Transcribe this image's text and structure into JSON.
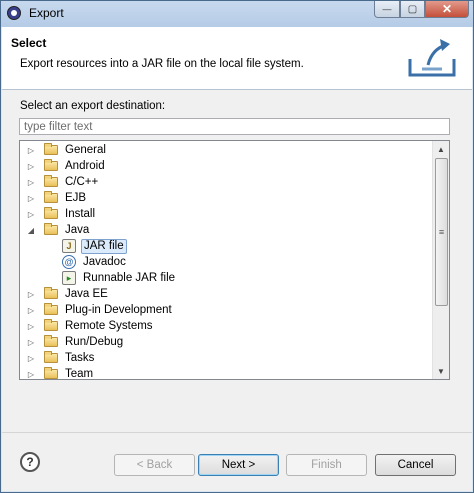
{
  "window": {
    "title": "Export",
    "close_glyph": "✕",
    "max_glyph": "▢",
    "min_glyph": "—"
  },
  "header": {
    "title": "Select",
    "description": "Export resources into a JAR file on the local file system."
  },
  "body": {
    "destination_label": "Select an export destination:",
    "filter_placeholder": "type filter text",
    "filter_value": ""
  },
  "tree": {
    "items": [
      {
        "label": "General",
        "expanded": false,
        "icon": "folder-icon"
      },
      {
        "label": "Android",
        "expanded": false,
        "icon": "folder-icon"
      },
      {
        "label": "C/C++",
        "expanded": false,
        "icon": "folder-icon"
      },
      {
        "label": "EJB",
        "expanded": false,
        "icon": "folder-icon"
      },
      {
        "label": "Install",
        "expanded": false,
        "icon": "folder-icon"
      },
      {
        "label": "Java",
        "expanded": true,
        "icon": "folder-icon",
        "children": [
          {
            "label": "JAR file",
            "selected": true,
            "icon": "jar-file-icon"
          },
          {
            "label": "Javadoc",
            "selected": false,
            "icon": "javadoc-icon"
          },
          {
            "label": "Runnable JAR file",
            "selected": false,
            "icon": "runnable-jar-icon"
          }
        ]
      },
      {
        "label": "Java EE",
        "expanded": false,
        "icon": "folder-icon"
      },
      {
        "label": "Plug-in Development",
        "expanded": false,
        "icon": "folder-icon"
      },
      {
        "label": "Remote Systems",
        "expanded": false,
        "icon": "folder-icon"
      },
      {
        "label": "Run/Debug",
        "expanded": false,
        "icon": "folder-icon"
      },
      {
        "label": "Tasks",
        "expanded": false,
        "icon": "folder-icon"
      },
      {
        "label": "Team",
        "expanded": false,
        "icon": "folder-icon"
      }
    ]
  },
  "buttons": {
    "help": "?",
    "back": "< Back",
    "next": "Next >",
    "finish": "Finish",
    "cancel": "Cancel"
  },
  "glyphs": {
    "collapsed": "▷",
    "expanded": "◢",
    "scroll_up": "▲",
    "scroll_down": "▼",
    "grip": "≡"
  }
}
